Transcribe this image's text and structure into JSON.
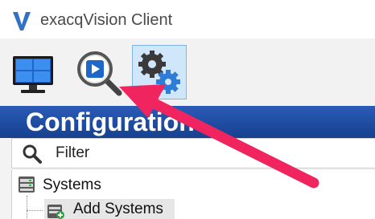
{
  "window": {
    "title": "exacqVision Client",
    "logo_icon": "exacq-v-logo-icon",
    "accent_color": "#2f72c6"
  },
  "toolbar": {
    "buttons": [
      {
        "name": "live",
        "icon": "monitor-grid-icon",
        "selected": false
      },
      {
        "name": "search",
        "icon": "magnifier-play-icon",
        "selected": false
      },
      {
        "name": "config",
        "icon": "gears-icon",
        "selected": true
      }
    ]
  },
  "config_panel": {
    "header": "Configuration",
    "header_color": "#1f4ea3",
    "filter": {
      "placeholder": "Filter",
      "value": "",
      "icon": "search-icon"
    }
  },
  "tree": {
    "items": [
      {
        "label": "Systems",
        "icon": "server-icon"
      },
      {
        "label": "Add Systems",
        "icon": "add-system-icon",
        "selected": true
      }
    ]
  },
  "annotation": {
    "arrow_color": "#f0245e",
    "points_to": "search"
  }
}
